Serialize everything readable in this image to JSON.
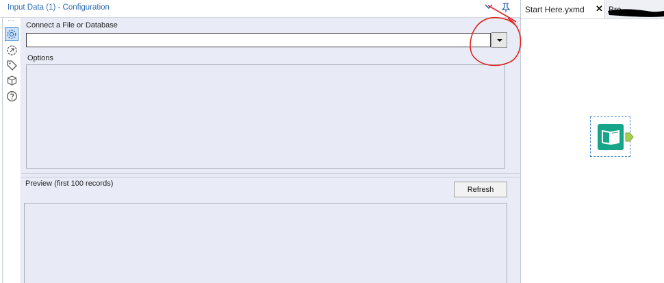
{
  "window": {
    "title": "Input Data (1) - Configuration"
  },
  "config": {
    "connect_label": "Connect a File or Database",
    "file_value": "",
    "options_label": "Options",
    "preview_label": "Preview (first 100 records)",
    "refresh_label": "Refresh"
  },
  "sidebar": {
    "icons": [
      "gear-icon",
      "arrow-circle-icon",
      "tag-icon",
      "cube-icon",
      "help-icon"
    ]
  },
  "tabs": [
    {
      "label": "Start Here.yxmd",
      "close": "✕"
    },
    {
      "label": "Bre...",
      "obscured": true
    }
  ],
  "canvas": {
    "tool": "input-data-tool",
    "tool_color": "#17a589"
  },
  "colors": {
    "accent": "#2f6db5",
    "annotation": "#e0201c"
  }
}
